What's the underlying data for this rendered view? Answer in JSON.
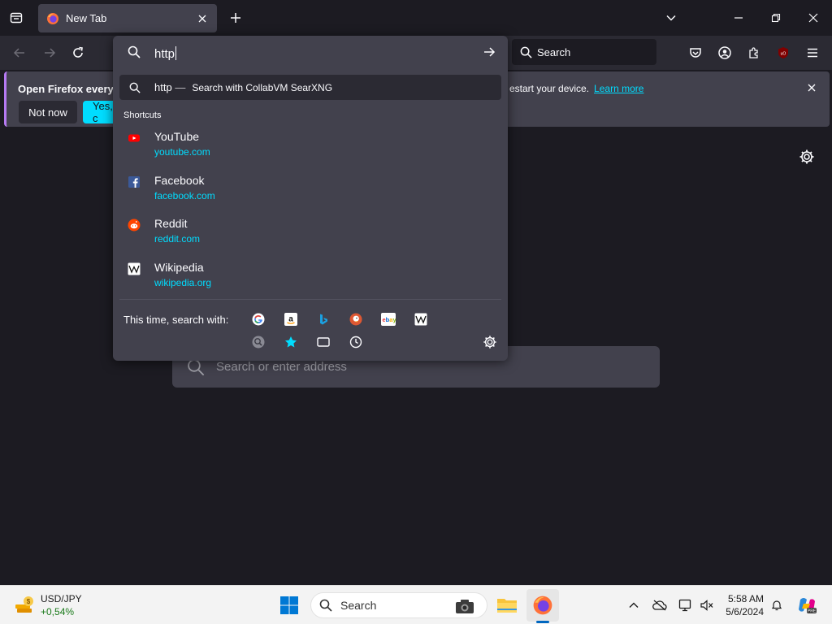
{
  "tab": {
    "title": "New Tab"
  },
  "toolbar": {
    "search_placeholder": "Search"
  },
  "notification": {
    "message": "Open Firefox every ti",
    "message_tail": "estart your device.",
    "learn_more": "Learn more",
    "not_now": "Not now",
    "yes_label": "Yes, c"
  },
  "urlbar": {
    "value": "http",
    "suggestion": {
      "query": "http",
      "separator": "—",
      "engine_text": "Search with CollabVM SearXNG"
    },
    "shortcuts_heading": "Shortcuts",
    "shortcuts": [
      {
        "name": "YouTube",
        "url": "youtube.com",
        "icon": "youtube-icon"
      },
      {
        "name": "Facebook",
        "url": "facebook.com",
        "icon": "facebook-icon"
      },
      {
        "name": "Reddit",
        "url": "reddit.com",
        "icon": "reddit-icon"
      },
      {
        "name": "Wikipedia",
        "url": "wikipedia.org",
        "icon": "wikipedia-icon"
      }
    ],
    "one_time_label": "This time, search with:",
    "engines": [
      "google-icon",
      "amazon-icon",
      "bing-icon",
      "duckduckgo-icon",
      "ebay-icon",
      "wikipedia-icon",
      "searxng-icon",
      "bookmarks-icon",
      "tabs-icon",
      "history-icon"
    ]
  },
  "page": {
    "search_placeholder": "Search or enter address"
  },
  "taskbar": {
    "widget_title": "USD/JPY",
    "widget_value": "+0,54%",
    "search_placeholder": "Search",
    "time": "5:58 AM",
    "date": "5/6/2024"
  },
  "colors": {
    "accent": "#00ddff",
    "frame": "#1c1b22",
    "toolbar": "#2b2a33",
    "panel": "#42414d"
  }
}
